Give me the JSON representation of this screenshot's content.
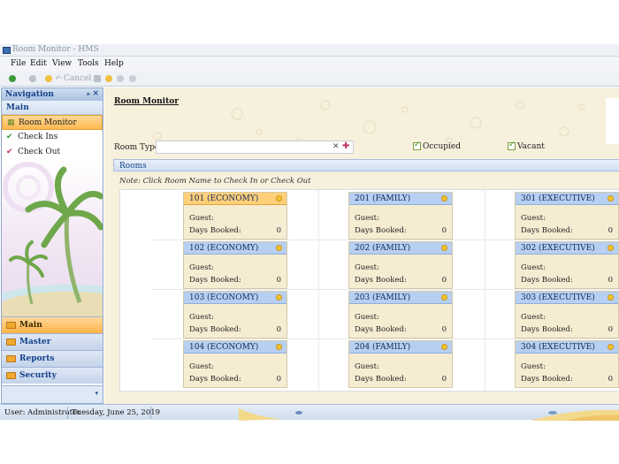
{
  "window": {
    "title": "Room Monitor - HMS"
  },
  "menu": {
    "items": [
      "File",
      "Edit",
      "View",
      "Tools",
      "Help"
    ]
  },
  "toolbar": {
    "cancel_label": "Cancel"
  },
  "navigation": {
    "title": "Navigation",
    "pin": "ᵖ",
    "close": "×",
    "section": "Main",
    "entries": [
      {
        "label": "Room Monitor",
        "icon": "grid-icon"
      },
      {
        "label": "Check Ins",
        "icon": "check-icon"
      },
      {
        "label": "Check Out",
        "icon": "check-icon"
      }
    ],
    "groups": [
      "Main",
      "Master",
      "Reports",
      "Security"
    ]
  },
  "page": {
    "title": "Room Monitor",
    "room_type_label": "Room Type:",
    "room_type_value": "",
    "occupied_label": "Occupied",
    "vacant_label": "Vacant",
    "rooms_title": "Rooms",
    "note": "Note: Click Room Name to Check In or Check Out",
    "guest_label": "Guest:",
    "days_label": "Days Booked:"
  },
  "rooms": [
    {
      "name": "101 (ECONOMY)",
      "guest": "",
      "days": "0",
      "selected": true
    },
    {
      "name": "102 (ECONOMY)",
      "guest": "",
      "days": "0"
    },
    {
      "name": "103 (ECONOMY)",
      "guest": "",
      "days": "0"
    },
    {
      "name": "104 (ECONOMY)",
      "guest": "",
      "days": "0"
    },
    {
      "name": "201 (FAMILY)",
      "guest": "",
      "days": "0"
    },
    {
      "name": "202 (FAMILY)",
      "guest": "",
      "days": "0"
    },
    {
      "name": "203 (FAMILY)",
      "guest": "",
      "days": "0"
    },
    {
      "name": "204 (FAMILY)",
      "guest": "",
      "days": "0"
    },
    {
      "name": "301 (EXECUTIVE)",
      "guest": "",
      "days": "0"
    },
    {
      "name": "302 (EXECUTIVE)",
      "guest": "",
      "days": "0"
    },
    {
      "name": "303 (EXECUTIVE)",
      "guest": "",
      "days": "0"
    },
    {
      "name": "304 (EXECUTIVE)",
      "guest": "",
      "days": "0"
    }
  ],
  "status": {
    "user": "User: Administrator",
    "date": "Tuesday, June 25, 2019"
  },
  "colors": {
    "accent": "#ffb94f",
    "header_blue": "#b7cff0",
    "card_bg": "#f6ecd2"
  }
}
